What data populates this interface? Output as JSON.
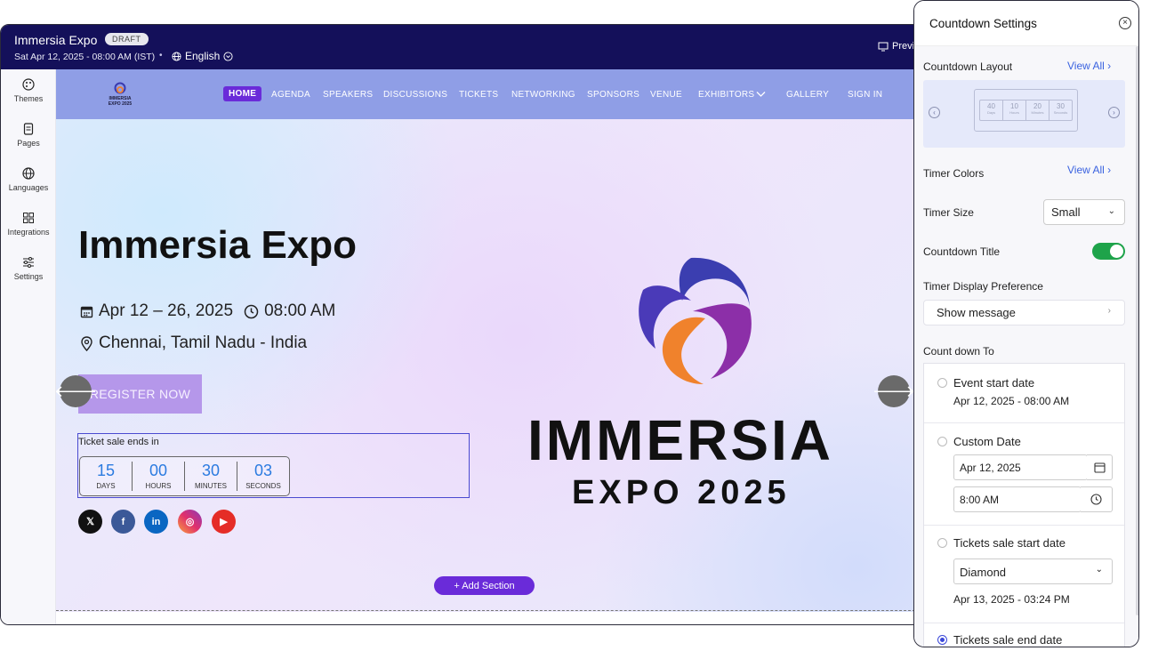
{
  "app": {
    "event_title": "Immersia Expo",
    "status_badge": "DRAFT",
    "datetime": "Sat Apr 12, 2025 - 08:00 AM (IST)",
    "separator": "•",
    "language": "English",
    "preview_label": "Previ"
  },
  "sidebar": {
    "items": [
      {
        "label": "Themes",
        "icon": "palette-icon"
      },
      {
        "label": "Pages",
        "icon": "pages-icon"
      },
      {
        "label": "Languages",
        "icon": "globe-icon"
      },
      {
        "label": "Integrations",
        "icon": "grid-icon"
      },
      {
        "label": "Settings",
        "icon": "sliders-icon"
      }
    ]
  },
  "site": {
    "logo_text": "IMMERSIA",
    "logo_sub": "EXPO 2025",
    "nav": [
      "HOME",
      "AGENDA",
      "SPEAKERS",
      "DISCUSSIONS",
      "TICKETS",
      "NETWORKING",
      "SPONSORS",
      "VENUE",
      "EXHIBITORS",
      "GALLERY",
      "SIGN IN"
    ],
    "hero_title": "Immersia Expo",
    "date_range": "Apr 12 – 26, 2025",
    "time": "08:00 AM",
    "location": "Chennai, Tamil Nadu - India",
    "register_label": "REGISTER NOW",
    "ticket_label": "Ticket sale ends in",
    "countdown": [
      {
        "value": "15",
        "unit": "DAYS"
      },
      {
        "value": "00",
        "unit": "HOURS"
      },
      {
        "value": "30",
        "unit": "MINUTES"
      },
      {
        "value": "03",
        "unit": "SECONDS"
      }
    ],
    "social": [
      {
        "name": "x",
        "glyph": "𝕏",
        "color": "#111111"
      },
      {
        "name": "facebook",
        "glyph": "f",
        "color": "#3b5998"
      },
      {
        "name": "linkedin",
        "glyph": "in",
        "color": "#0a66c2"
      },
      {
        "name": "instagram",
        "glyph": "◎",
        "color": "#e1306c"
      },
      {
        "name": "youtube",
        "glyph": "▶",
        "color": "#e52d27"
      }
    ],
    "brand_name": "IMMERSIA",
    "brand_sub": "EXPO 2025",
    "add_section_label": "+ Add Section"
  },
  "panel": {
    "title": "Countdown Settings",
    "layout_label": "Countdown Layout",
    "view_all": "View All",
    "mini_timer": [
      {
        "value": "40",
        "unit": "Days"
      },
      {
        "value": "10",
        "unit": "Hours"
      },
      {
        "value": "20",
        "unit": "Minutes"
      },
      {
        "value": "30",
        "unit": "Seconds"
      }
    ],
    "timer_colors_label": "Timer Colors",
    "timer_colors_view_all": "View All",
    "timer_size_label": "Timer Size",
    "timer_size_value": "Small",
    "countdown_title_label": "Countdown Title",
    "countdown_title_on": true,
    "display_pref_label": "Timer Display Preference",
    "display_pref_value": "Show message",
    "count_down_to_label": "Count down To",
    "options": {
      "event_start": {
        "label": "Event start date",
        "value": "Apr 12, 2025 - 08:00 AM"
      },
      "custom_date": {
        "label": "Custom Date",
        "date": "Apr 12, 2025",
        "time": "8:00 AM"
      },
      "tickets_start": {
        "label": "Tickets sale start date",
        "ticket": "Diamond",
        "value": "Apr 13, 2025 - 03:24 PM"
      },
      "tickets_end": {
        "label": "Tickets sale end date"
      }
    }
  },
  "colors": {
    "topbar": "#14105a",
    "accent": "#6a2bd9",
    "link": "#3b63e0",
    "toggle_on": "#1ea34a",
    "timer_number": "#2b7be0"
  }
}
